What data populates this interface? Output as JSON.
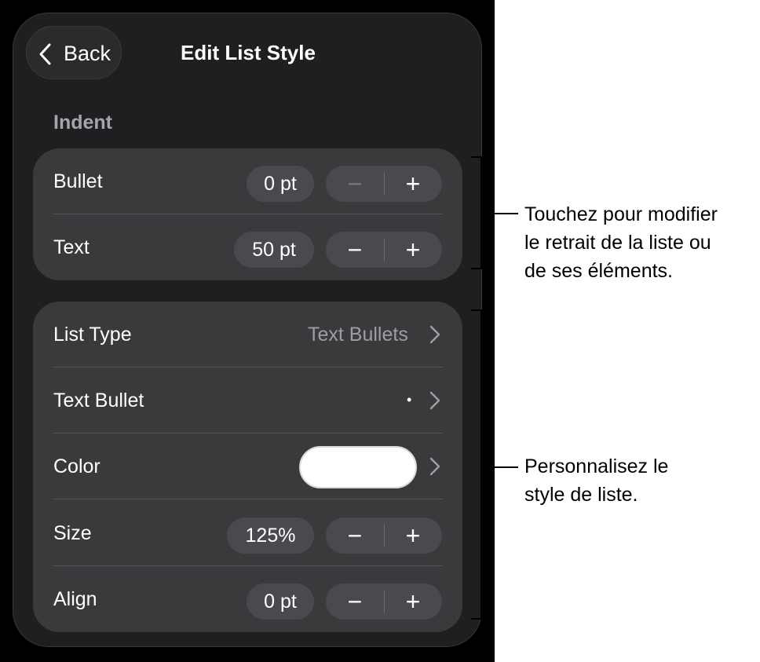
{
  "header": {
    "back_label": "Back",
    "title": "Edit List Style"
  },
  "indent": {
    "section_label": "Indent",
    "bullet": {
      "label": "Bullet",
      "value": "0 pt",
      "minus": "−",
      "plus": "+"
    },
    "text": {
      "label": "Text",
      "value": "50 pt",
      "minus": "−",
      "plus": "+"
    }
  },
  "style": {
    "list_type": {
      "label": "List Type",
      "value": "Text Bullets"
    },
    "text_bullet": {
      "label": "Text Bullet",
      "value": "•"
    },
    "color": {
      "label": "Color",
      "swatch": "#ffffff"
    },
    "size": {
      "label": "Size",
      "value": "125%",
      "minus": "−",
      "plus": "+"
    },
    "align": {
      "label": "Align",
      "value": "0 pt",
      "minus": "−",
      "plus": "+"
    }
  },
  "callouts": {
    "indent": [
      "Touchez pour modifier",
      "le retrait de la liste ou",
      "de ses éléments."
    ],
    "style": [
      "Personnalisez le",
      "style de liste."
    ]
  },
  "colors": {
    "panel_bg": "#1f1f21",
    "group_bg": "#3a3a3d",
    "control_bg": "#4a4a4e",
    "secondary_text": "#9d9da2"
  }
}
